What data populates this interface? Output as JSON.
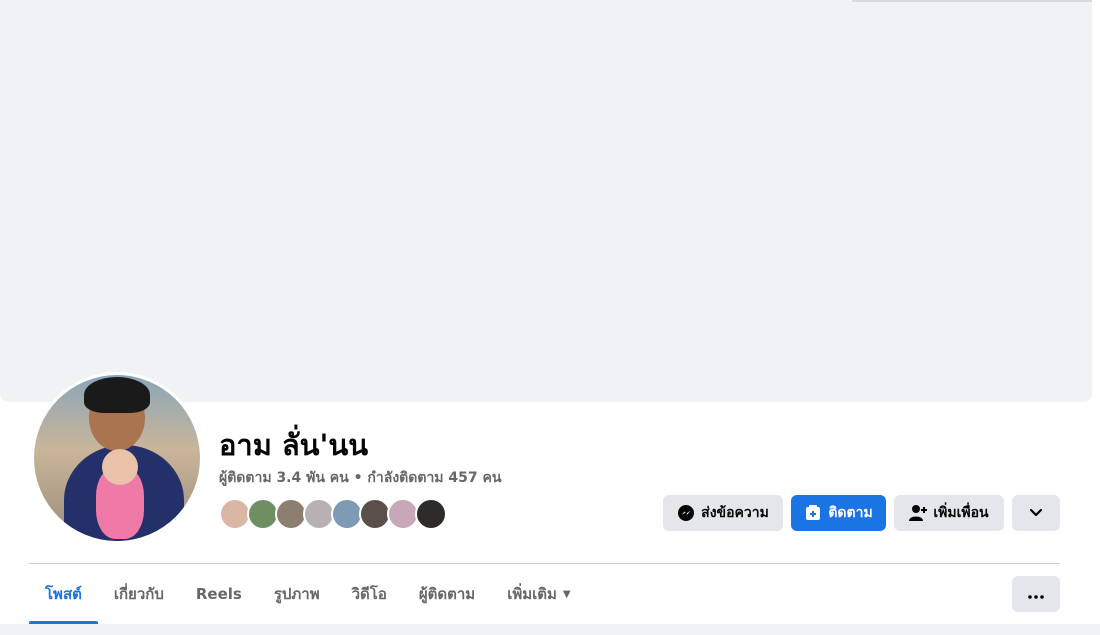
{
  "profile": {
    "name": "อาม ลั่น'นน",
    "stats": "ผู้ติดตาม 3.4 พัน คน • กำลังติดตาม 457 คน",
    "friend_colors": [
      "#d9b7a4",
      "#6f8f63",
      "#8c7f70",
      "#b8b1b4",
      "#7e9ab4",
      "#5a4f4a",
      "#c7a8b8",
      "#2f2b29"
    ]
  },
  "actions": {
    "message_label": "ส่งข้อความ",
    "follow_label": "ติดตาม",
    "add_friend_label": "เพิ่มเพื่อน"
  },
  "tabs": [
    {
      "label": "โพสต์"
    },
    {
      "label": "เกี่ยวกับ"
    },
    {
      "label": "Reels"
    },
    {
      "label": "รูปภาพ"
    },
    {
      "label": "วิดีโอ"
    },
    {
      "label": "ผู้ติดตาม"
    },
    {
      "label": "เพิ่มเติม"
    }
  ],
  "colors": {
    "accent": "#1b74e4",
    "button_gray": "#e4e6eb",
    "cover": "#f0f2f5"
  }
}
